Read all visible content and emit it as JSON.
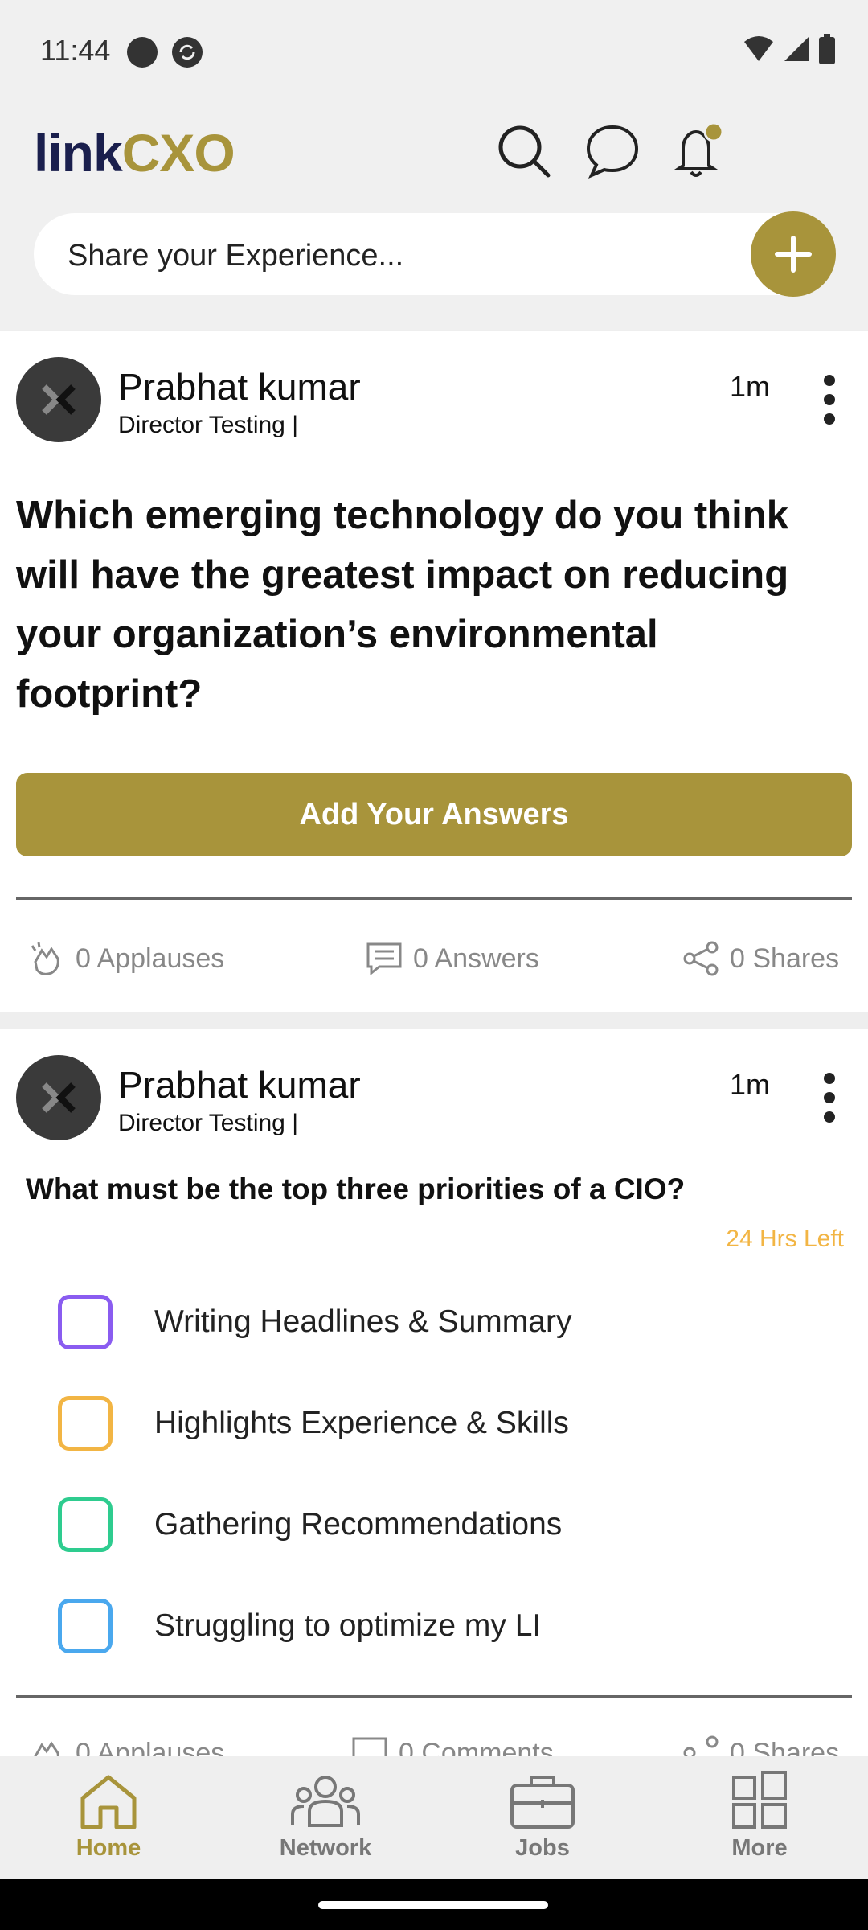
{
  "status_bar": {
    "time": "11:44"
  },
  "header": {
    "logo_part1": "link",
    "logo_part2": "CXO",
    "share_placeholder": "Share your Experience..."
  },
  "posts": [
    {
      "author": "Prabhat kumar",
      "author_title": "Director Testing |",
      "time": "1m",
      "question": "Which emerging technology do you think will have the greatest impact on reducing your organization’s environmental footprint?",
      "cta_label": "Add Your Answers",
      "stats": {
        "applauses": "0 Applauses",
        "answers": "0 Answers",
        "shares": "0 Shares"
      }
    },
    {
      "author": "Prabhat kumar",
      "author_title": "Director Testing |",
      "time": "1m",
      "question": "What must be the top three priorities of a CIO?",
      "time_left": "24 Hrs Left",
      "options": [
        {
          "label": "Writing Headlines & Summary",
          "color": "#8a5cf0"
        },
        {
          "label": "Highlights Experience & Skills",
          "color": "#f2b544"
        },
        {
          "label": "Gathering Recommendations",
          "color": "#2ecc8f"
        },
        {
          "label": "Struggling to optimize my LI",
          "color": "#4aa8ee"
        }
      ],
      "stats": {
        "applauses": "0 Applauses",
        "comments": "0 Comments",
        "shares": "0 Shares"
      }
    }
  ],
  "bottom_nav": [
    {
      "label": "Home",
      "icon": "home-icon",
      "active": true
    },
    {
      "label": "Network",
      "icon": "people-icon",
      "active": false
    },
    {
      "label": "Jobs",
      "icon": "briefcase-icon",
      "active": false
    },
    {
      "label": "More",
      "icon": "grid-icon",
      "active": false
    }
  ],
  "colors": {
    "brand_gold": "#a8943b",
    "brand_navy": "#1a1f4d"
  }
}
